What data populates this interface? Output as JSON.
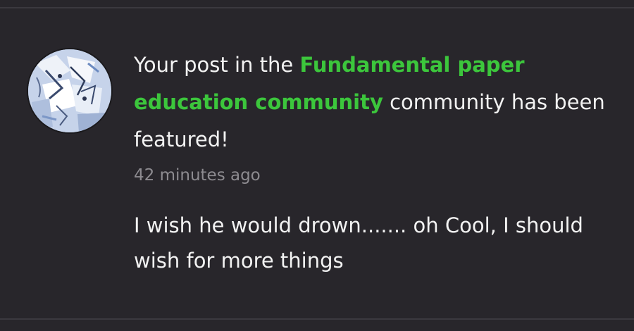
{
  "notification": {
    "text_before": "Your post in the ",
    "community_name": "Fundamental paper education community",
    "text_after": " community has been featured!",
    "timestamp": "42 minutes ago",
    "post_excerpt": "I wish he would drown....... oh Cool, I should wish for more things"
  },
  "colors": {
    "background": "#28262b",
    "accent_link": "#3cc63c",
    "text_primary": "#f2f2f2",
    "text_secondary": "#8d8b90"
  },
  "icons": {
    "avatar": "user-avatar-image"
  }
}
